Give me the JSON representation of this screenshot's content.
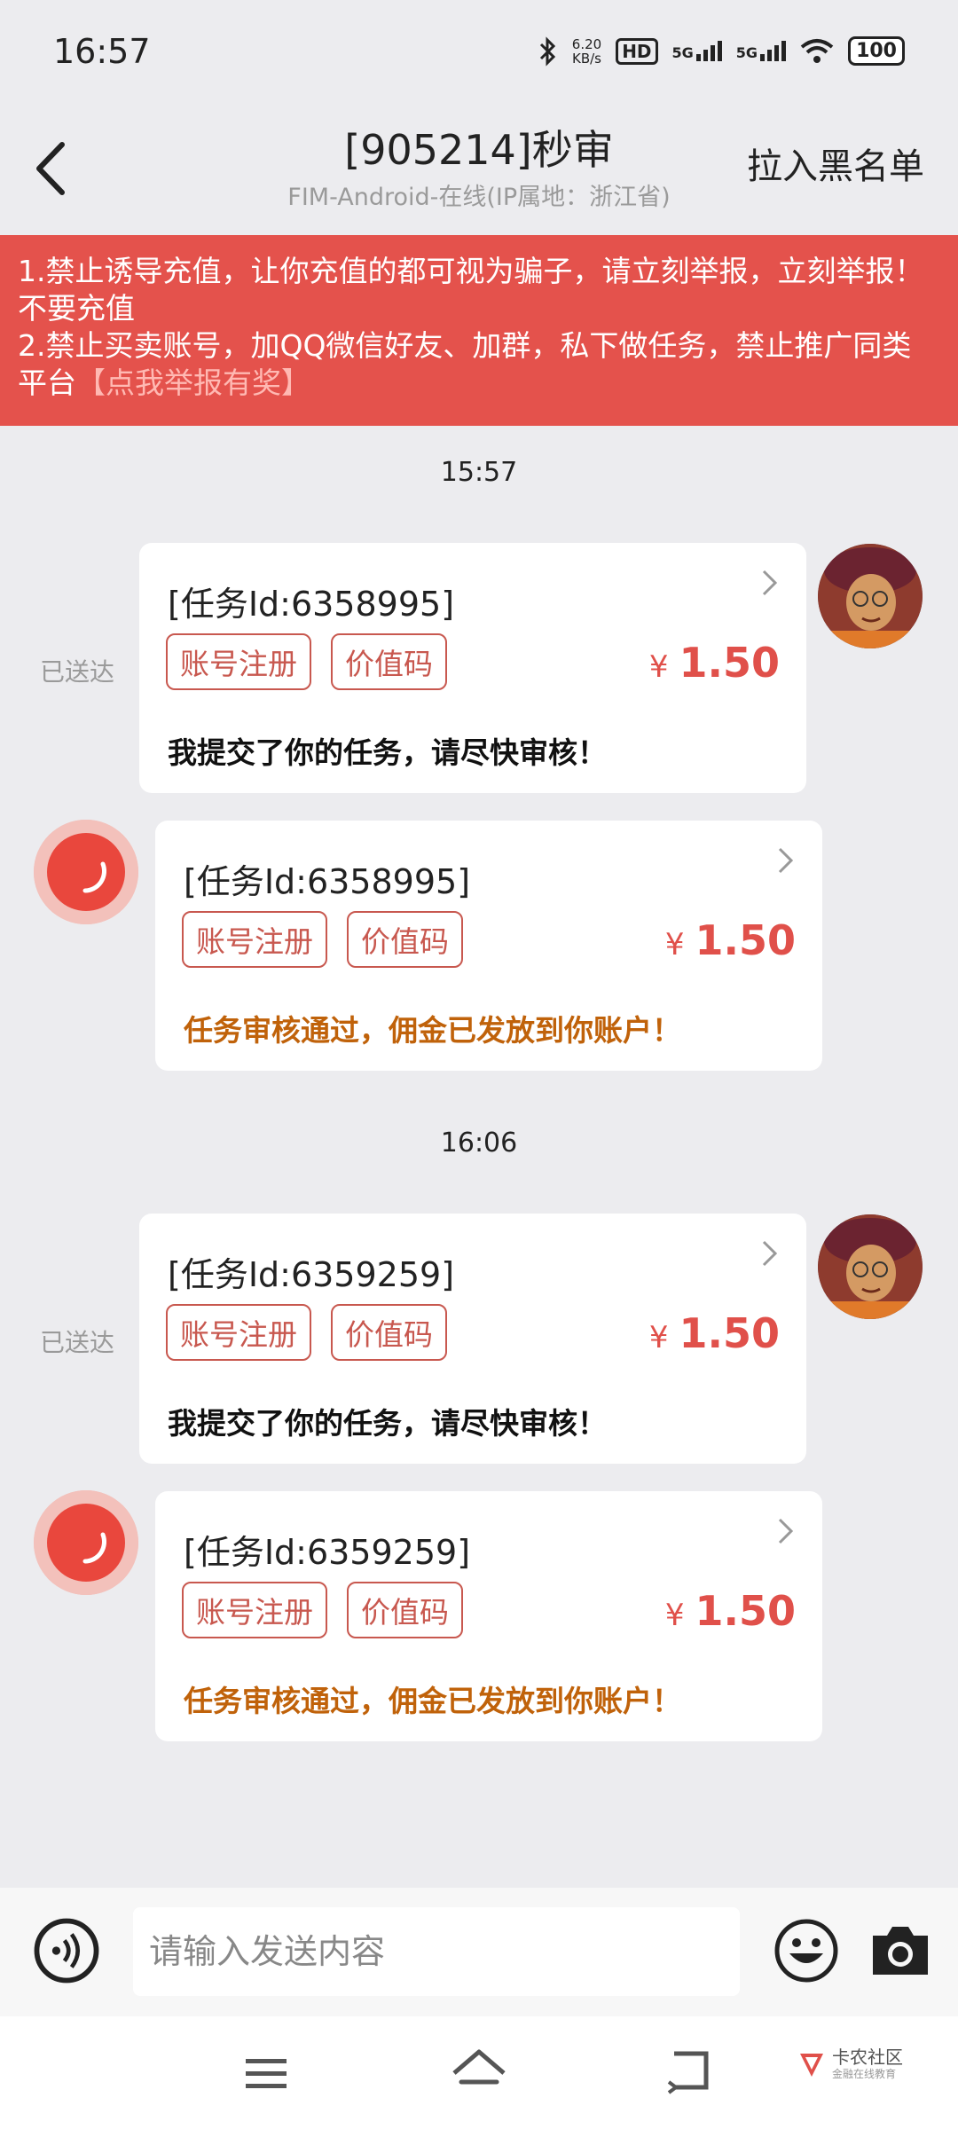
{
  "status_bar": {
    "time": "16:57",
    "net_speed_value": "6.20",
    "net_speed_unit": "KB/s",
    "hd_label": "HD",
    "signal1_label": "5G",
    "signal2_label": "5G",
    "battery": "100"
  },
  "header": {
    "title": "[905214]秒审",
    "subtitle": "FIM-Android-在线(IP属地：浙江省)",
    "blacklist_label": "拉入黑名单"
  },
  "notice": {
    "text": "1.禁止诱导充值，让你充值的都可视为骗子，请立刻举报，立刻举报！不要充值\n2.禁止买卖账号，加QQ微信好友、加群，私下做任务，禁止推广同类平台",
    "report_link": "【点我举报有奖】"
  },
  "conversation": {
    "groups": [
      {
        "time": "15:57",
        "sent": {
          "delivered_label": "已送达",
          "task_id": "[任务Id:6358995]",
          "tags": [
            "账号注册",
            "价值码"
          ],
          "currency": "¥",
          "price": "1.50",
          "message": "我提交了你的任务，请尽快审核！"
        },
        "reply": {
          "task_id": "[任务Id:6358995]",
          "tags": [
            "账号注册",
            "价值码"
          ],
          "currency": "¥",
          "price": "1.50",
          "message": "任务审核通过，佣金已发放到你账户！"
        }
      },
      {
        "time": "16:06",
        "sent": {
          "delivered_label": "已送达",
          "task_id": "[任务Id:6359259]",
          "tags": [
            "账号注册",
            "价值码"
          ],
          "currency": "¥",
          "price": "1.50",
          "message": "我提交了你的任务，请尽快审核！"
        },
        "reply": {
          "task_id": "[任务Id:6359259]",
          "tags": [
            "账号注册",
            "价值码"
          ],
          "currency": "¥",
          "price": "1.50",
          "message": "任务审核通过，佣金已发放到你账户！"
        }
      }
    ]
  },
  "input": {
    "placeholder": "请输入发送内容"
  },
  "watermark": {
    "name": "卡农社区",
    "tagline": "金融在线教育"
  },
  "colors": {
    "notice_bg": "#e4524c",
    "price": "#e0504a",
    "tag": "#c8584f",
    "approved_text": "#c0620a"
  }
}
